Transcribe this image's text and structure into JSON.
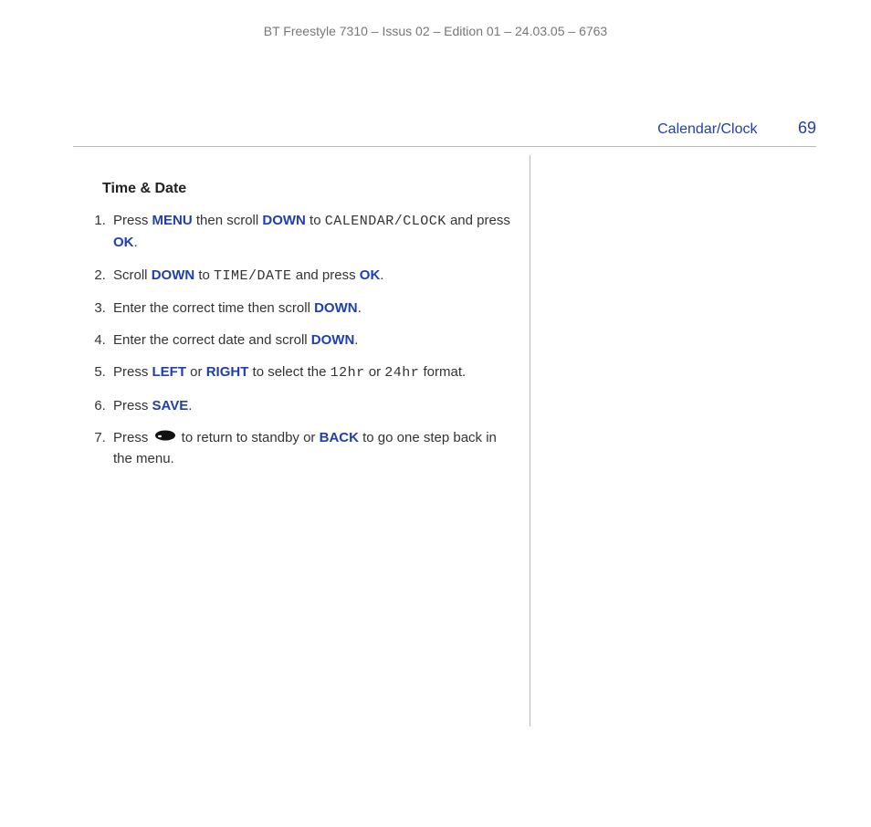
{
  "header": {
    "docinfo": "BT Freestyle 7310 – Issus 02 – Edition 01 – 24.03.05 – 6763"
  },
  "runningHead": {
    "section": "Calendar/Clock",
    "pageNumber": "69"
  },
  "content": {
    "subhead": "Time & Date",
    "keys": {
      "menu": "MENU",
      "down": "DOWN",
      "ok": "OK",
      "left": "LEFT",
      "right": "RIGHT",
      "save": "SAVE",
      "back": "BACK"
    },
    "lcd": {
      "calendarClock": "CALENDAR/CLOCK",
      "timeDate": "TIME/DATE",
      "hr12": "12hr",
      "hr24": "24hr"
    },
    "plain": {
      "s1a": "Press ",
      "s1b": " then scroll ",
      "s1c": " to ",
      "s1d": " and press ",
      "period": ".",
      "s2a": "Scroll ",
      "s2b": " to ",
      "s2c": " and press ",
      "s3a": "Enter the correct time then scroll ",
      "s4a": "Enter the correct date and scroll ",
      "s5a": "Press ",
      "s5b": " or ",
      "s5c": " to select the ",
      "s5d": " or ",
      "s5e": " format.",
      "s6a": "Press ",
      "s7a": "Press ",
      "s7b": " to return to standby or ",
      "s7c": " to go one step back in the menu."
    }
  }
}
